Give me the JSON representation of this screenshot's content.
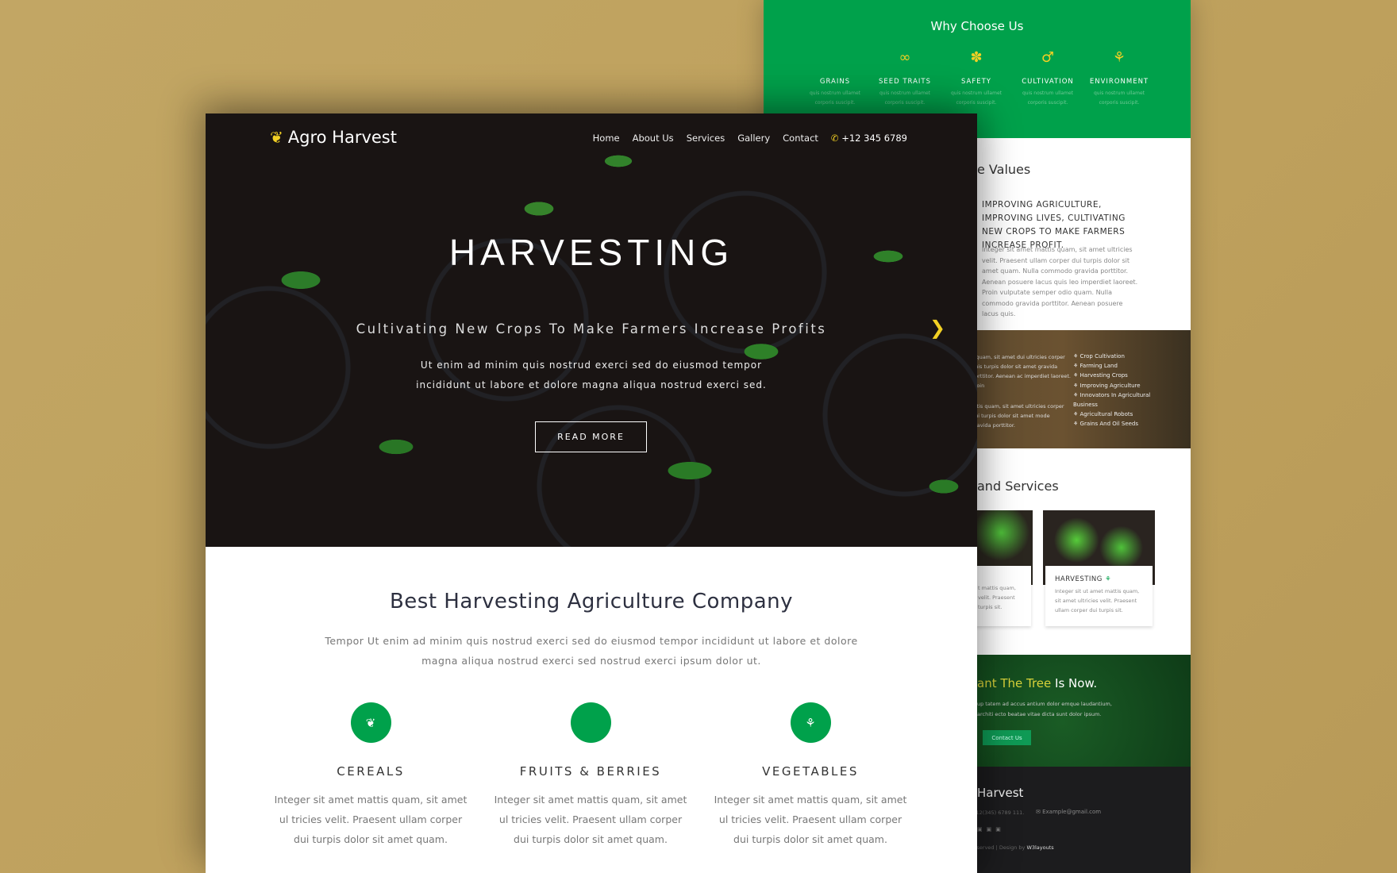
{
  "back_page": {
    "why": {
      "title": "Why Choose Us",
      "items": [
        {
          "icon": "apple-icon",
          "glyph": "",
          "label": "GRAINS",
          "text": "quis nostrum ullamet corporis suscipit."
        },
        {
          "icon": "infinity-seed-icon",
          "glyph": "∞",
          "label": "SEED TRAITS",
          "text": "quis nostrum ullamet corporis suscipit."
        },
        {
          "icon": "yelp-icon",
          "glyph": "✽",
          "label": "SAFETY",
          "text": "quis nostrum ullamet corporis suscipit."
        },
        {
          "icon": "sprout-icon",
          "glyph": "♂",
          "label": "CULTIVATION",
          "text": "quis nostrum ullamet corporis suscipit."
        },
        {
          "icon": "pagelines-icon",
          "glyph": "⚘",
          "label": "ENVIRONMENT",
          "text": "quis nostrum ullamet corporis suscipit."
        }
      ]
    },
    "values": {
      "heading": "e Values",
      "subheading": "IMPROVING AGRICULTURE, IMPROVING LIVES, CULTIVATING NEW CROPS TO MAKE FARMERS INCREASE PROFIT.",
      "text": "Integer sit amet mattis quam, sit amet ultricies velit. Praesent ullam corper dui turpis dolor sit amet quam. Nulla commodo gravida porttitor. Aenean posuere lacus quis leo imperdiet laoreet. Proin vulputate semper odio quam. Nulla commodo gravida porttitor. Aenean posuere lacus quis."
    },
    "photo_section": {
      "left_text_1": "s quam, sit amet dui ultricies corper duis turpis dolor sit amet gravida porttitor. Aenean ac imperdiet laoreet. Proin",
      "left_text_2": "attis quam, sit amet ultricies corper dui turpis dolor sit amet mode gravida porttitor.",
      "list": [
        "Crop Cultivation",
        "Farming Land",
        "Harvesting Crops",
        "Improving Agriculture",
        "Innovators In Agricultural Business",
        "Agricultural Robots",
        "Grains And Oil Seeds"
      ]
    },
    "services": {
      "heading": "and Services",
      "cards": [
        {
          "title": "",
          "text": "t mattis quam, velit. Praesent turpis sit."
        },
        {
          "title": "HARVESTING",
          "text": "Integer sit ut amet mattis quam, sit amet ultricies velit. Praesent ullam corper dui turpis sit."
        }
      ]
    },
    "cta": {
      "title_highlight": "ant The Tree",
      "title_rest": " Is Now.",
      "text": "up tatem ad accus antium dolor emque laudantium, architi ecto beatae vitae dicta sunt dolor ipsum.",
      "button": "Contact Us"
    },
    "footer": {
      "brand": "Harvest",
      "phone": "+12(345) 6789 111.",
      "email": "Example@gmail.com",
      "copyright": "reserved | Design by ",
      "designer": "W3layouts"
    }
  },
  "front_page": {
    "brand": "Agro Harvest",
    "nav": [
      "Home",
      "About Us",
      "Services",
      "Gallery",
      "Contact"
    ],
    "phone": "+12 345 6789",
    "hero": {
      "title": "HARVESTING",
      "subtitle": "Cultivating New Crops To Make Farmers Increase Profits",
      "text_1": "Ut enim ad minim quis nostrud exerci sed do eiusmod tempor",
      "text_2": "incididunt ut labore et dolore magna aliqua nostrud exerci sed.",
      "button": "READ MORE"
    },
    "about": {
      "title": "Best Harvesting Agriculture Company",
      "text": "Tempor Ut enim ad minim quis nostrud exerci sed do eiusmod tempor incididunt ut labore et dolore magna aliqua nostrud exerci sed nostrud exerci ipsum dolor ut."
    },
    "features": [
      {
        "icon": "leaf-icon",
        "glyph": "❦",
        "title": "CEREALS",
        "text": "Integer sit amet mattis quam, sit amet ul tricies velit. Praesent ullam corper dui turpis dolor sit amet quam."
      },
      {
        "icon": "apple-icon",
        "glyph": "",
        "title": "FRUITS & BERRIES",
        "text": "Integer sit amet mattis quam, sit amet ul tricies velit. Praesent ullam corper dui turpis dolor sit amet quam."
      },
      {
        "icon": "plant-icon",
        "glyph": "⚘",
        "title": "VEGETABLES",
        "text": "Integer sit amet mattis quam, sit amet ul tricies velit. Praesent ullam corper dui turpis dolor sit amet quam."
      }
    ]
  },
  "colors": {
    "brand_green": "#00a14b",
    "accent_yellow": "#f2d024",
    "background": "#c0a460"
  }
}
